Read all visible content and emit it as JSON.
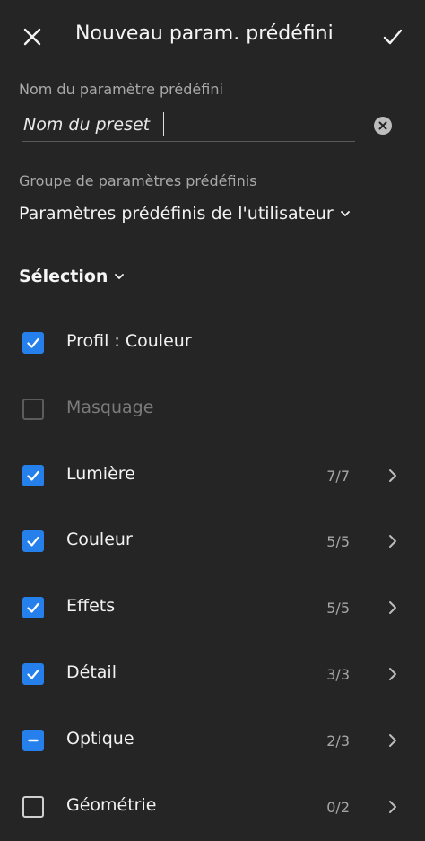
{
  "header": {
    "title": "Nouveau param. prédéfini",
    "close_icon": "close-icon",
    "confirm_icon": "checkmark-icon"
  },
  "preset_name": {
    "label": "Nom du paramètre prédéfini",
    "placeholder": "Nom du preset",
    "value": ""
  },
  "preset_group": {
    "label": "Groupe de paramètres prédéfinis",
    "value": "Paramètres prédéfinis de l'utilisateur"
  },
  "selection": {
    "label": "Sélection"
  },
  "items": [
    {
      "label": "Profil : Couleur",
      "state": "checked",
      "count": "",
      "has_chevron": false
    },
    {
      "label": "Masquage",
      "state": "disabled",
      "count": "",
      "has_chevron": false
    },
    {
      "label": "Lumière",
      "state": "checked",
      "count": "7/7",
      "has_chevron": true
    },
    {
      "label": "Couleur",
      "state": "checked",
      "count": "5/5",
      "has_chevron": true
    },
    {
      "label": "Effets",
      "state": "checked",
      "count": "5/5",
      "has_chevron": true
    },
    {
      "label": "Détail",
      "state": "checked",
      "count": "3/3",
      "has_chevron": true
    },
    {
      "label": "Optique",
      "state": "partial",
      "count": "2/3",
      "has_chevron": true
    },
    {
      "label": "Géométrie",
      "state": "unchecked",
      "count": "0/2",
      "has_chevron": true
    }
  ],
  "colors": {
    "background": "#252525",
    "accent": "#2680eb",
    "text": "#f2f2f2",
    "muted_text": "#a9a9a9"
  }
}
